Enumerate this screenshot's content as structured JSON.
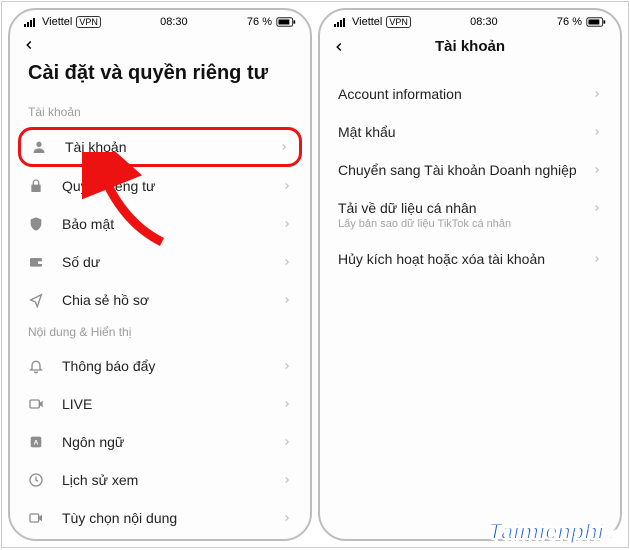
{
  "status": {
    "carrier": "Viettel",
    "vpn": "VPN",
    "time": "08:30",
    "battery": "76 %"
  },
  "left": {
    "title": "Cài đặt và quyền riêng tư",
    "section_account": "Tài khoản",
    "items_account": {
      "account": "Tài khoản",
      "privacy": "Quyền riêng tư",
      "security": "Bảo mật",
      "balance": "Số dư",
      "share": "Chia sẻ hồ sơ"
    },
    "section_content": "Nội dung & Hiển thị",
    "items_content": {
      "push": "Thông báo đẩy",
      "live": "LIVE",
      "language": "Ngôn ngữ",
      "history": "Lịch sử xem",
      "content_pref": "Tùy chọn nội dung"
    }
  },
  "right": {
    "header_title": "Tài khoản",
    "items": {
      "info": "Account information",
      "password": "Mật khẩu",
      "business": "Chuyển sang Tài khoản Doanh nghiệp",
      "download": "Tải về dữ liệu cá nhân",
      "download_sub": "Lấy bản sao dữ liệu TikTok cá nhân",
      "delete": "Hủy kích hoạt hoặc xóa tài khoản"
    }
  },
  "watermark": {
    "main": "Taimienphi",
    "sub": ".vn"
  }
}
